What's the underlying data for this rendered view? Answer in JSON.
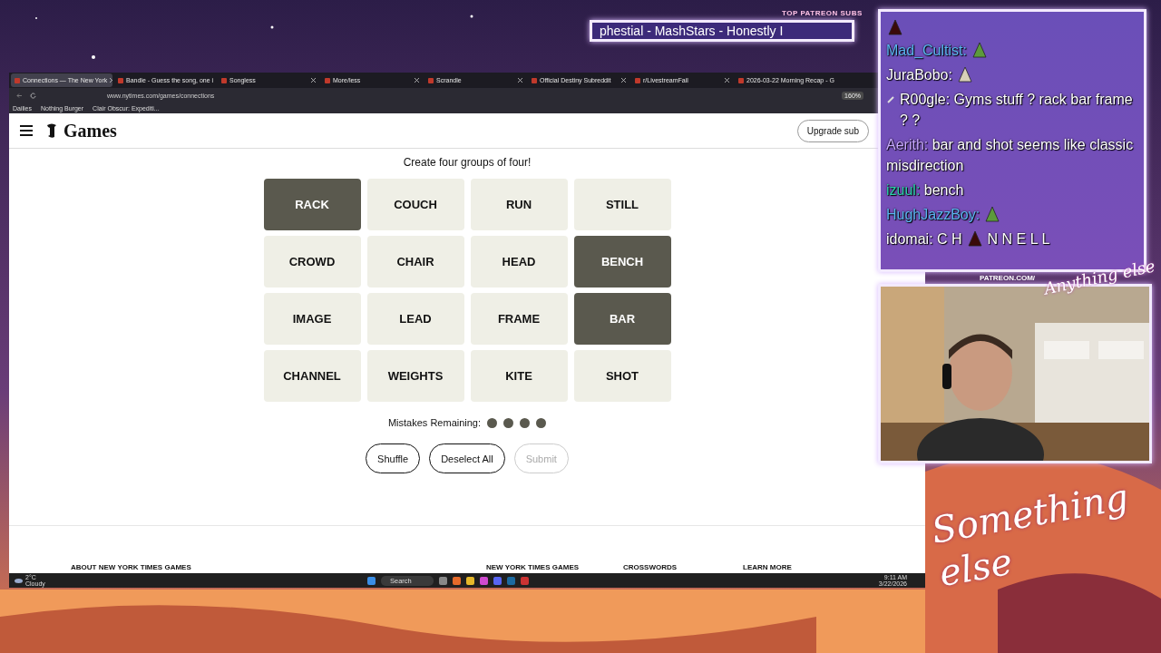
{
  "browser": {
    "tabs": [
      {
        "label": "Connections — The New York",
        "selected": true
      },
      {
        "label": "Bandle - Guess the song, one i",
        "selected": false
      },
      {
        "label": "Songless",
        "selected": false
      },
      {
        "label": "More/less",
        "selected": false
      },
      {
        "label": "Scrandle",
        "selected": false
      },
      {
        "label": "Official Destiny Subreddit",
        "selected": false
      },
      {
        "label": "r/LivestreamFail",
        "selected": false
      },
      {
        "label": "2026-03-22 Morning Recap - G",
        "selected": false
      }
    ],
    "address": "www.nytimes.com/games/connections",
    "zoom": "160%",
    "bookmarks": [
      "Dailies",
      "Nothing Burger",
      "Clair Obscur: Expediti..."
    ]
  },
  "page": {
    "logo": "Games",
    "upgrade": "Upgrade sub",
    "instruction": "Create four groups of four!",
    "tiles": [
      {
        "word": "RACK",
        "selected": true
      },
      {
        "word": "COUCH",
        "selected": false
      },
      {
        "word": "RUN",
        "selected": false
      },
      {
        "word": "STILL",
        "selected": false
      },
      {
        "word": "CROWD",
        "selected": false
      },
      {
        "word": "CHAIR",
        "selected": false
      },
      {
        "word": "HEAD",
        "selected": false
      },
      {
        "word": "BENCH",
        "selected": true
      },
      {
        "word": "IMAGE",
        "selected": false
      },
      {
        "word": "LEAD",
        "selected": false
      },
      {
        "word": "FRAME",
        "selected": false
      },
      {
        "word": "BAR",
        "selected": true
      },
      {
        "word": "CHANNEL",
        "selected": false
      },
      {
        "word": "WEIGHTS",
        "selected": false
      },
      {
        "word": "KITE",
        "selected": false
      },
      {
        "word": "SHOT",
        "selected": false
      }
    ],
    "mistakes_label": "Mistakes Remaining:",
    "mistakes": [
      {
        "remaining": true
      },
      {
        "remaining": true
      },
      {
        "remaining": true
      },
      {
        "remaining": true
      }
    ],
    "buttons": [
      {
        "label": "Shuffle",
        "disabled": false
      },
      {
        "label": "Deselect All",
        "disabled": false
      },
      {
        "label": "Submit",
        "disabled": true
      }
    ],
    "footer": [
      "ABOUT NEW YORK TIMES GAMES",
      "NEW YORK TIMES GAMES",
      "CROSSWORDS",
      "LEARN MORE"
    ]
  },
  "taskbar": {
    "temperature": "2°C",
    "weather": "Cloudy",
    "search": "Search",
    "time": "9:11 AM",
    "date": "3/22/2026"
  },
  "overlay": {
    "patreon_title": "TOP PATREON SUBS",
    "ticker": "phestial - MashStars - Honestly I",
    "chat": [
      {
        "parts": [
          {
            "kind": "emote",
            "color": "#3a0a0a"
          }
        ]
      },
      {
        "parts": [
          {
            "kind": "user",
            "text": "Mad_Cultist:",
            "color": "#5ab4f0"
          },
          {
            "kind": "emote",
            "color": "#5c9a3c"
          }
        ]
      },
      {
        "parts": [
          {
            "kind": "user",
            "text": "JuraBobo:",
            "color": "#ffffff"
          },
          {
            "kind": "emote",
            "color": "#d8cfb8"
          }
        ]
      },
      {
        "parts": [
          {
            "kind": "badge"
          },
          {
            "kind": "user",
            "text": "R00gle:",
            "color": "#ffffff"
          },
          {
            "kind": "text",
            "text": "Gyms stuff ? rack bar frame ? ?"
          }
        ]
      },
      {
        "parts": [
          {
            "kind": "user",
            "text": "Aerith:",
            "color": "#c8a8ff"
          },
          {
            "kind": "text",
            "text": "bar and shot seems like classic misdirection"
          }
        ]
      },
      {
        "parts": [
          {
            "kind": "user",
            "text": "izuul:",
            "color": "#2ad0a8"
          },
          {
            "kind": "text",
            "text": "bench"
          }
        ]
      },
      {
        "parts": [
          {
            "kind": "user",
            "text": "HughJazzBoy:",
            "color": "#5ab4f0"
          },
          {
            "kind": "emote",
            "color": "#5c9a3c"
          }
        ]
      },
      {
        "parts": [
          {
            "kind": "user",
            "text": "idomai:",
            "color": "#ffffff"
          },
          {
            "kind": "text",
            "text": "C H"
          },
          {
            "kind": "emote",
            "color": "#3a0a0a"
          },
          {
            "kind": "text",
            "text": "N N E L L"
          }
        ]
      }
    ],
    "patreon_url": "PATREON.COM/",
    "signature": "Anything else",
    "brand": "Something else"
  }
}
